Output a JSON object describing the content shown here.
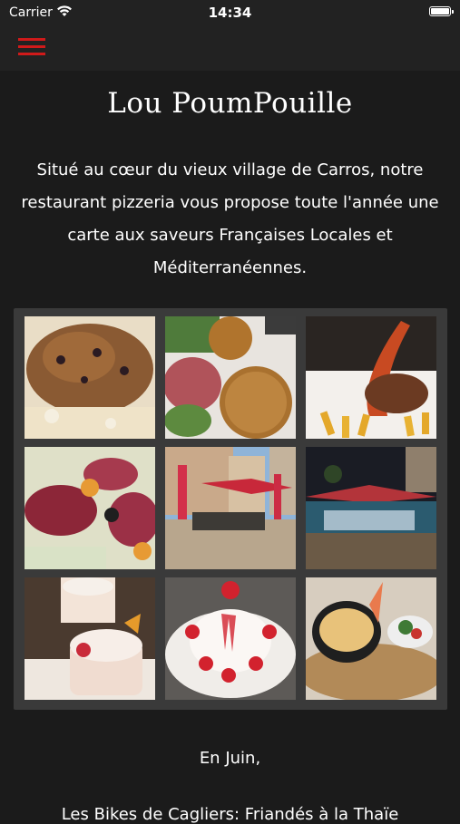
{
  "status_bar": {
    "carrier": "Carrier",
    "time": "14:34"
  },
  "nav": {
    "menu_icon": "hamburger-menu-icon"
  },
  "page": {
    "title": "Lou PoumPouille",
    "intro": "Situé au cœur du vieux village de Carros, notre restaurant pizzeria vous propose toute l'année une carte aux saveurs Françaises Locales et Méditerranéennes.",
    "month_heading": "En Juin,",
    "cut_off_line": "Les Bikes de Cagliers: Friandés à la Thaïe"
  },
  "colors": {
    "background": "#1b1b1b",
    "accent": "#d01a1a",
    "gallery_bg": "#3a3a3a"
  },
  "gallery": [
    {
      "subject": "pizza"
    },
    {
      "subject": "arancini-and-charcuterie"
    },
    {
      "subject": "lobster-with-fries"
    },
    {
      "subject": "charcuterie-pizza"
    },
    {
      "subject": "village-terrace"
    },
    {
      "subject": "night-terrace"
    },
    {
      "subject": "dessert-verrines"
    },
    {
      "subject": "strawberry-dessert"
    },
    {
      "subject": "gratin-dish"
    }
  ]
}
